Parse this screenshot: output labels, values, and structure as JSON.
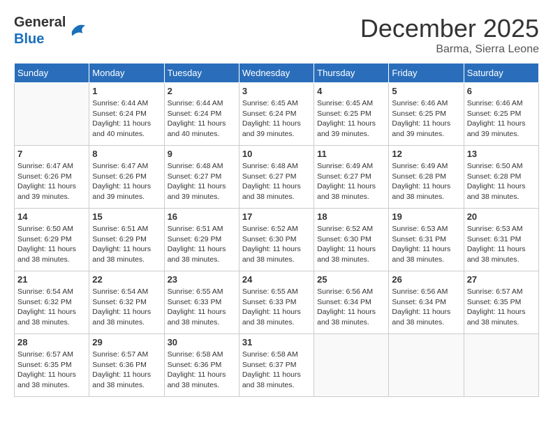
{
  "header": {
    "logo_general": "General",
    "logo_blue": "Blue",
    "month_year": "December 2025",
    "location": "Barma, Sierra Leone"
  },
  "weekdays": [
    "Sunday",
    "Monday",
    "Tuesday",
    "Wednesday",
    "Thursday",
    "Friday",
    "Saturday"
  ],
  "weeks": [
    [
      {
        "day": "",
        "info": ""
      },
      {
        "day": "1",
        "info": "Sunrise: 6:44 AM\nSunset: 6:24 PM\nDaylight: 11 hours\nand 40 minutes."
      },
      {
        "day": "2",
        "info": "Sunrise: 6:44 AM\nSunset: 6:24 PM\nDaylight: 11 hours\nand 40 minutes."
      },
      {
        "day": "3",
        "info": "Sunrise: 6:45 AM\nSunset: 6:24 PM\nDaylight: 11 hours\nand 39 minutes."
      },
      {
        "day": "4",
        "info": "Sunrise: 6:45 AM\nSunset: 6:25 PM\nDaylight: 11 hours\nand 39 minutes."
      },
      {
        "day": "5",
        "info": "Sunrise: 6:46 AM\nSunset: 6:25 PM\nDaylight: 11 hours\nand 39 minutes."
      },
      {
        "day": "6",
        "info": "Sunrise: 6:46 AM\nSunset: 6:25 PM\nDaylight: 11 hours\nand 39 minutes."
      }
    ],
    [
      {
        "day": "7",
        "info": "Sunrise: 6:47 AM\nSunset: 6:26 PM\nDaylight: 11 hours\nand 39 minutes."
      },
      {
        "day": "8",
        "info": "Sunrise: 6:47 AM\nSunset: 6:26 PM\nDaylight: 11 hours\nand 39 minutes."
      },
      {
        "day": "9",
        "info": "Sunrise: 6:48 AM\nSunset: 6:27 PM\nDaylight: 11 hours\nand 39 minutes."
      },
      {
        "day": "10",
        "info": "Sunrise: 6:48 AM\nSunset: 6:27 PM\nDaylight: 11 hours\nand 38 minutes."
      },
      {
        "day": "11",
        "info": "Sunrise: 6:49 AM\nSunset: 6:27 PM\nDaylight: 11 hours\nand 38 minutes."
      },
      {
        "day": "12",
        "info": "Sunrise: 6:49 AM\nSunset: 6:28 PM\nDaylight: 11 hours\nand 38 minutes."
      },
      {
        "day": "13",
        "info": "Sunrise: 6:50 AM\nSunset: 6:28 PM\nDaylight: 11 hours\nand 38 minutes."
      }
    ],
    [
      {
        "day": "14",
        "info": "Sunrise: 6:50 AM\nSunset: 6:29 PM\nDaylight: 11 hours\nand 38 minutes."
      },
      {
        "day": "15",
        "info": "Sunrise: 6:51 AM\nSunset: 6:29 PM\nDaylight: 11 hours\nand 38 minutes."
      },
      {
        "day": "16",
        "info": "Sunrise: 6:51 AM\nSunset: 6:29 PM\nDaylight: 11 hours\nand 38 minutes."
      },
      {
        "day": "17",
        "info": "Sunrise: 6:52 AM\nSunset: 6:30 PM\nDaylight: 11 hours\nand 38 minutes."
      },
      {
        "day": "18",
        "info": "Sunrise: 6:52 AM\nSunset: 6:30 PM\nDaylight: 11 hours\nand 38 minutes."
      },
      {
        "day": "19",
        "info": "Sunrise: 6:53 AM\nSunset: 6:31 PM\nDaylight: 11 hours\nand 38 minutes."
      },
      {
        "day": "20",
        "info": "Sunrise: 6:53 AM\nSunset: 6:31 PM\nDaylight: 11 hours\nand 38 minutes."
      }
    ],
    [
      {
        "day": "21",
        "info": "Sunrise: 6:54 AM\nSunset: 6:32 PM\nDaylight: 11 hours\nand 38 minutes."
      },
      {
        "day": "22",
        "info": "Sunrise: 6:54 AM\nSunset: 6:32 PM\nDaylight: 11 hours\nand 38 minutes."
      },
      {
        "day": "23",
        "info": "Sunrise: 6:55 AM\nSunset: 6:33 PM\nDaylight: 11 hours\nand 38 minutes."
      },
      {
        "day": "24",
        "info": "Sunrise: 6:55 AM\nSunset: 6:33 PM\nDaylight: 11 hours\nand 38 minutes."
      },
      {
        "day": "25",
        "info": "Sunrise: 6:56 AM\nSunset: 6:34 PM\nDaylight: 11 hours\nand 38 minutes."
      },
      {
        "day": "26",
        "info": "Sunrise: 6:56 AM\nSunset: 6:34 PM\nDaylight: 11 hours\nand 38 minutes."
      },
      {
        "day": "27",
        "info": "Sunrise: 6:57 AM\nSunset: 6:35 PM\nDaylight: 11 hours\nand 38 minutes."
      }
    ],
    [
      {
        "day": "28",
        "info": "Sunrise: 6:57 AM\nSunset: 6:35 PM\nDaylight: 11 hours\nand 38 minutes."
      },
      {
        "day": "29",
        "info": "Sunrise: 6:57 AM\nSunset: 6:36 PM\nDaylight: 11 hours\nand 38 minutes."
      },
      {
        "day": "30",
        "info": "Sunrise: 6:58 AM\nSunset: 6:36 PM\nDaylight: 11 hours\nand 38 minutes."
      },
      {
        "day": "31",
        "info": "Sunrise: 6:58 AM\nSunset: 6:37 PM\nDaylight: 11 hours\nand 38 minutes."
      },
      {
        "day": "",
        "info": ""
      },
      {
        "day": "",
        "info": ""
      },
      {
        "day": "",
        "info": ""
      }
    ]
  ]
}
